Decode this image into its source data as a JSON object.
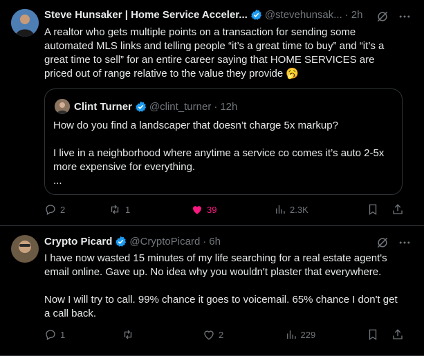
{
  "tweets": [
    {
      "name": "Steve Hunsaker | Home Service Acceler...",
      "handle": "@stevehunsak...",
      "time": "2h",
      "text": "A realtor who gets multiple points on a transaction for sending some automated MLS links and telling people “it’s a great time to buy” and “it’s a great time to sell” for an entire career saying that HOME SERVICES are priced out of range relative to the value they provide 🥱",
      "quote": {
        "name": "Clint Turner",
        "handle": "@clint_turner",
        "time": "12h",
        "text": "How do you find a landscaper that doesn’t charge 5x markup?\n\nI live in a neighborhood where anytime a service co comes it’s auto 2-5x more expensive for everything.\n..."
      },
      "actions": {
        "replies": "2",
        "reposts": "1",
        "likes": "39",
        "views": "2.3K"
      }
    },
    {
      "name": "Crypto Picard",
      "handle": "@CryptoPicard",
      "time": "6h",
      "text": "I have now wasted 15 minutes of my life searching for a real estate agent's email online. Gave up. No idea why you wouldn't plaster that everywhere.\n\nNow I will try to call. 99% chance it goes to voicemail. 65% chance I don't get a call back.",
      "actions": {
        "replies": "1",
        "reposts": "",
        "likes": "2",
        "views": "229"
      }
    }
  ],
  "colors": {
    "accent": "#1d9bf0",
    "like": "#f91880",
    "muted": "#71767b",
    "border": "#2f3336"
  }
}
